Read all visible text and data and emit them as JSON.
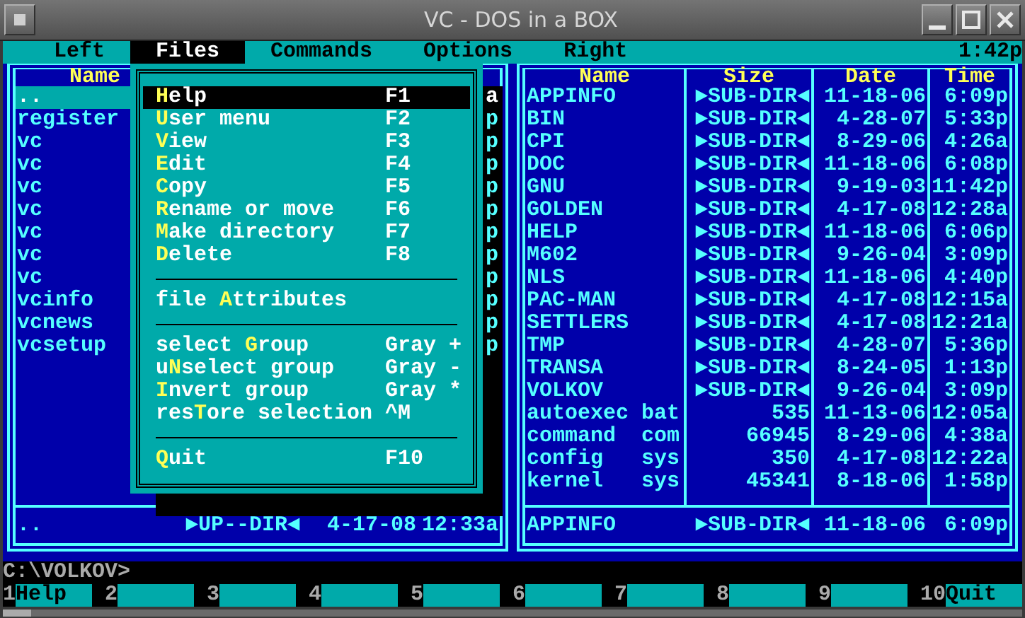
{
  "window": {
    "title": "VC - DOS in a BOX"
  },
  "menu_bar": {
    "items": [
      {
        "label": "Left",
        "selected": false
      },
      {
        "label": "Files",
        "selected": true
      },
      {
        "label": "Commands",
        "selected": false
      },
      {
        "label": "Options",
        "selected": false
      },
      {
        "label": "Right",
        "selected": false
      }
    ],
    "clock": "1:42p"
  },
  "left_panel": {
    "headers": [
      "Name"
    ],
    "rows": [
      {
        "name": "..",
        "time": "a",
        "selected": true
      },
      {
        "name": "register",
        "time": "p",
        "selected": false
      },
      {
        "name": "vc",
        "time": "p",
        "selected": false
      },
      {
        "name": "vc",
        "time": "p",
        "selected": false
      },
      {
        "name": "vc",
        "time": "p",
        "selected": false
      },
      {
        "name": "vc",
        "time": "p",
        "selected": false
      },
      {
        "name": "vc",
        "time": "p",
        "selected": false
      },
      {
        "name": "vc",
        "time": "p",
        "selected": false
      },
      {
        "name": "vc",
        "time": "p",
        "selected": false
      },
      {
        "name": "vcinfo",
        "time": "p",
        "selected": false
      },
      {
        "name": "vcnews",
        "time": "p",
        "selected": false
      },
      {
        "name": "vcsetup",
        "time": "p",
        "selected": false
      }
    ],
    "info": {
      "name": "..",
      "size": "►UP--DIR◄",
      "date": "4-17-08",
      "time": "12:33a"
    }
  },
  "right_panel": {
    "headers": [
      "Name",
      "Size",
      "Date",
      "Time"
    ],
    "rows": [
      {
        "name": "APPINFO",
        "size": "►SUB-DIR◄",
        "date": "11-18-06",
        "time": "6:09p",
        "selected": false
      },
      {
        "name": "BIN",
        "size": "►SUB-DIR◄",
        "date": "4-28-07",
        "time": "5:33p",
        "selected": false
      },
      {
        "name": "CPI",
        "size": "►SUB-DIR◄",
        "date": "8-29-06",
        "time": "4:26a",
        "selected": false
      },
      {
        "name": "DOC",
        "size": "►SUB-DIR◄",
        "date": "11-18-06",
        "time": "6:08p",
        "selected": false
      },
      {
        "name": "GNU",
        "size": "►SUB-DIR◄",
        "date": "9-19-03",
        "time": "11:42p",
        "selected": false
      },
      {
        "name": "GOLDEN",
        "size": "►SUB-DIR◄",
        "date": "4-17-08",
        "time": "12:28a",
        "selected": false
      },
      {
        "name": "HELP",
        "size": "►SUB-DIR◄",
        "date": "11-18-06",
        "time": "6:06p",
        "selected": false
      },
      {
        "name": "M602",
        "size": "►SUB-DIR◄",
        "date": "9-26-04",
        "time": "3:09p",
        "selected": false
      },
      {
        "name": "NLS",
        "size": "►SUB-DIR◄",
        "date": "11-18-06",
        "time": "4:40p",
        "selected": false
      },
      {
        "name": "PAC-MAN",
        "size": "►SUB-DIR◄",
        "date": "4-17-08",
        "time": "12:15a",
        "selected": false
      },
      {
        "name": "SETTLERS",
        "size": "►SUB-DIR◄",
        "date": "4-17-08",
        "time": "12:21a",
        "selected": false
      },
      {
        "name": "TMP",
        "size": "►SUB-DIR◄",
        "date": "4-28-07",
        "time": "5:36p",
        "selected": false
      },
      {
        "name": "TRANSA",
        "size": "►SUB-DIR◄",
        "date": "8-24-05",
        "time": "1:13p",
        "selected": false
      },
      {
        "name": "VOLKOV",
        "size": "►SUB-DIR◄",
        "date": "9-26-04",
        "time": "3:09p",
        "selected": false
      },
      {
        "name": "autoexec",
        "ext": "bat",
        "size": "535",
        "date": "11-13-06",
        "time": "12:05a",
        "selected": false
      },
      {
        "name": "command",
        "ext": "com",
        "size": "66945",
        "date": "8-29-06",
        "time": "4:38a",
        "selected": false
      },
      {
        "name": "config",
        "ext": "sys",
        "size": "350",
        "date": "4-17-08",
        "time": "12:22a",
        "selected": false
      },
      {
        "name": "kernel",
        "ext": "sys",
        "size": "45341",
        "date": "8-18-06",
        "time": "1:58p",
        "selected": false
      }
    ],
    "info": {
      "name": "APPINFO",
      "size": "►SUB-DIR◄",
      "date": "11-18-06",
      "time": "6:09p"
    }
  },
  "files_menu": {
    "items": [
      {
        "kind": "item",
        "hotkey": "H",
        "after": "elp",
        "shortcut": "F1",
        "selected": true
      },
      {
        "kind": "item",
        "hotkey": "U",
        "after": "ser menu",
        "shortcut": "F2",
        "selected": false
      },
      {
        "kind": "item",
        "hotkey": "V",
        "after": "iew",
        "shortcut": "F3",
        "selected": false
      },
      {
        "kind": "item",
        "hotkey": "E",
        "after": "dit",
        "shortcut": "F4",
        "selected": false
      },
      {
        "kind": "item",
        "hotkey": "C",
        "after": "opy",
        "shortcut": "F5",
        "selected": false
      },
      {
        "kind": "item",
        "hotkey": "R",
        "after": "ename or move",
        "shortcut": "F6",
        "selected": false
      },
      {
        "kind": "item",
        "hotkey": "M",
        "after": "ake directory",
        "shortcut": "F7",
        "selected": false
      },
      {
        "kind": "item",
        "hotkey": "D",
        "after": "elete",
        "shortcut": "F8",
        "selected": false
      },
      {
        "kind": "separator"
      },
      {
        "kind": "item",
        "before": "file ",
        "hotkey": "A",
        "after": "ttributes",
        "selected": false
      },
      {
        "kind": "separator"
      },
      {
        "kind": "item",
        "before": "select ",
        "hotkey": "G",
        "after": "roup",
        "shortcut": "Gray +",
        "selected": false
      },
      {
        "kind": "item",
        "before": "u",
        "hotkey": "N",
        "after": "select group",
        "shortcut": "Gray -",
        "selected": false
      },
      {
        "kind": "item",
        "hotkey": "I",
        "after": "nvert group",
        "shortcut": "Gray *",
        "selected": false
      },
      {
        "kind": "item",
        "before": "res",
        "hotkey": "T",
        "after": "ore selection",
        "shortcut": "^M",
        "selected": false
      },
      {
        "kind": "separator"
      },
      {
        "kind": "item",
        "hotkey": "Q",
        "after": "uit",
        "shortcut": "F10",
        "selected": false
      }
    ]
  },
  "command_line": "C:\\VOLKOV>",
  "function_keys": [
    {
      "number": "1",
      "label": "Help"
    },
    {
      "number": "2"
    },
    {
      "number": "3"
    },
    {
      "number": "4"
    },
    {
      "number": "5"
    },
    {
      "number": "6"
    },
    {
      "number": "7"
    },
    {
      "number": "8"
    },
    {
      "number": "9"
    },
    {
      "number": "10",
      "label": "Quit"
    }
  ]
}
